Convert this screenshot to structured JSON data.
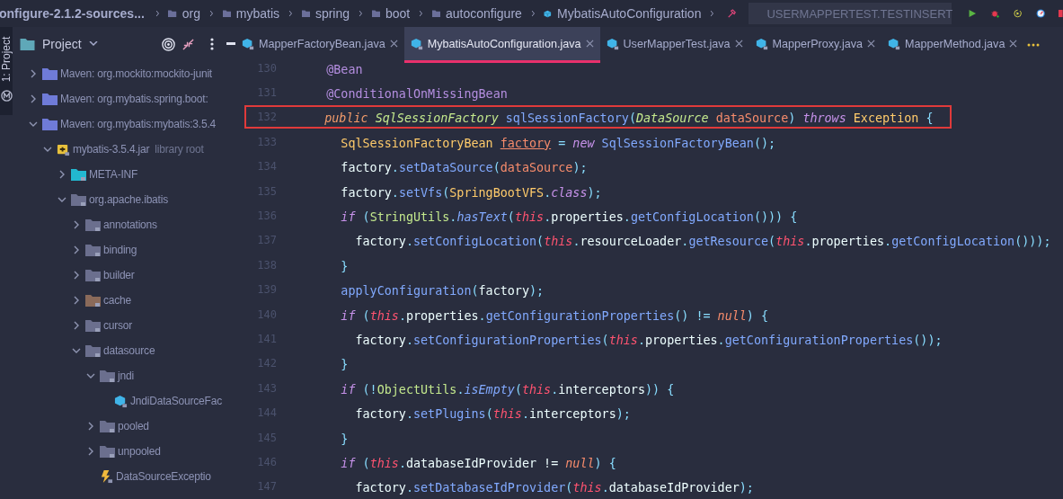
{
  "breadcrumb": {
    "project": "onfigure-2.1.2-sources...",
    "items": [
      {
        "label": "org",
        "kind": "folder"
      },
      {
        "label": "mybatis",
        "kind": "folder"
      },
      {
        "label": "spring",
        "kind": "folder"
      },
      {
        "label": "boot",
        "kind": "folder"
      },
      {
        "label": "autoconfigure",
        "kind": "folder"
      },
      {
        "label": "MybatisAutoConfiguration",
        "kind": "class"
      }
    ]
  },
  "run_config": {
    "label": "USERMAPPERTEST.TESTINSERT"
  },
  "tool_strip": {
    "label": "1: Project"
  },
  "sidebar": {
    "title": "Project",
    "tree": [
      {
        "label": "Maven: org.mockito:mockito-junit",
        "kind": "module",
        "expanded": false
      },
      {
        "label": "Maven: org.mybatis.spring.boot:",
        "kind": "module",
        "expanded": false
      },
      {
        "label": "Maven: org.mybatis:mybatis:3.5.4",
        "kind": "module",
        "expanded": true,
        "children": [
          {
            "label": "mybatis-3.5.4.jar",
            "suffix": "library root",
            "kind": "jar",
            "expanded": true,
            "children": [
              {
                "label": "META-INF",
                "kind": "resources",
                "expanded": false
              },
              {
                "label": "org.apache.ibatis",
                "kind": "package",
                "expanded": true,
                "children": [
                  {
                    "label": "annotations",
                    "kind": "package",
                    "expanded": false
                  },
                  {
                    "label": "binding",
                    "kind": "package",
                    "expanded": false
                  },
                  {
                    "label": "builder",
                    "kind": "package",
                    "expanded": false
                  },
                  {
                    "label": "cache",
                    "kind": "cache",
                    "expanded": false
                  },
                  {
                    "label": "cursor",
                    "kind": "package",
                    "expanded": false
                  },
                  {
                    "label": "datasource",
                    "kind": "package",
                    "expanded": true,
                    "children": [
                      {
                        "label": "jndi",
                        "kind": "package",
                        "expanded": true,
                        "children": [
                          {
                            "label": "JndiDataSourceFac",
                            "kind": "class"
                          }
                        ]
                      },
                      {
                        "label": "pooled",
                        "kind": "package",
                        "expanded": false
                      },
                      {
                        "label": "unpooled",
                        "kind": "package",
                        "expanded": false
                      },
                      {
                        "label": "DataSourceExceptio",
                        "kind": "exception"
                      }
                    ]
                  }
                ]
              }
            ]
          }
        ]
      }
    ]
  },
  "tabs": [
    {
      "label": "MapperFactoryBean.java",
      "selected": false
    },
    {
      "label": "MybatisAutoConfiguration.java",
      "selected": true
    },
    {
      "label": "UserMapperTest.java",
      "selected": false
    },
    {
      "label": "MapperProxy.java",
      "selected": false
    },
    {
      "label": "MapperMethod.java",
      "selected": false
    }
  ],
  "code": [
    {
      "number": "130",
      "boxed": false,
      "tokens": [
        {
          "kind": "ann",
          "text": "    @Bean"
        }
      ]
    },
    {
      "number": "131",
      "boxed": false,
      "tokens": [
        {
          "kind": "ann",
          "text": "    @ConditionalOnMissingBean"
        }
      ]
    },
    {
      "number": "132",
      "boxed": true,
      "tokens": [
        {
          "kind": "mod",
          "text": "    public "
        },
        {
          "kind": "iface",
          "text": "SqlSessionFactory "
        },
        {
          "kind": "method",
          "text": "sqlSessionFactory"
        },
        {
          "kind": "punct",
          "text": "("
        },
        {
          "kind": "iface",
          "text": "DataSource "
        },
        {
          "kind": "param",
          "text": "dataSource"
        },
        {
          "kind": "punct",
          "text": ") "
        },
        {
          "kind": "kw",
          "text": "throws "
        },
        {
          "kind": "type",
          "text": "Exception"
        },
        {
          "kind": "punct",
          "text": " {"
        }
      ]
    },
    {
      "number": "133",
      "boxed": false,
      "tokens": [
        {
          "kind": "type",
          "text": "      SqlSessionFactoryBean "
        },
        {
          "kind": "var",
          "text": "factory"
        },
        {
          "kind": "punct",
          "text": " = "
        },
        {
          "kind": "kw",
          "text": "new "
        },
        {
          "kind": "method",
          "text": "SqlSessionFactoryBean"
        },
        {
          "kind": "punct",
          "text": "();"
        }
      ]
    },
    {
      "number": "134",
      "boxed": false,
      "tokens": [
        {
          "kind": "plain",
          "text": "      factory"
        },
        {
          "kind": "punct",
          "text": "."
        },
        {
          "kind": "method",
          "text": "setDataSource"
        },
        {
          "kind": "punct",
          "text": "("
        },
        {
          "kind": "param",
          "text": "dataSource"
        },
        {
          "kind": "punct",
          "text": ");"
        }
      ]
    },
    {
      "number": "135",
      "boxed": false,
      "tokens": [
        {
          "kind": "plain",
          "text": "      factory"
        },
        {
          "kind": "punct",
          "text": "."
        },
        {
          "kind": "method",
          "text": "setVfs"
        },
        {
          "kind": "punct",
          "text": "("
        },
        {
          "kind": "type",
          "text": "SpringBootVFS"
        },
        {
          "kind": "punct",
          "text": "."
        },
        {
          "kind": "kw",
          "text": "class"
        },
        {
          "kind": "punct",
          "text": ");"
        }
      ]
    },
    {
      "number": "136",
      "boxed": false,
      "tokens": [
        {
          "kind": "kw",
          "text": "      if"
        },
        {
          "kind": "punct",
          "text": " ("
        },
        {
          "kind": "cls",
          "text": "StringUtils"
        },
        {
          "kind": "punct",
          "text": "."
        },
        {
          "kind": "static",
          "text": "hasText"
        },
        {
          "kind": "punct",
          "text": "("
        },
        {
          "kind": "this",
          "text": "this"
        },
        {
          "kind": "punct",
          "text": "."
        },
        {
          "kind": "plain",
          "text": "properties"
        },
        {
          "kind": "punct",
          "text": "."
        },
        {
          "kind": "method",
          "text": "getConfigLocation"
        },
        {
          "kind": "punct",
          "text": "())) {"
        }
      ]
    },
    {
      "number": "137",
      "boxed": false,
      "tokens": [
        {
          "kind": "plain",
          "text": "        factory"
        },
        {
          "kind": "punct",
          "text": "."
        },
        {
          "kind": "method",
          "text": "setConfigLocation"
        },
        {
          "kind": "punct",
          "text": "("
        },
        {
          "kind": "this",
          "text": "this"
        },
        {
          "kind": "punct",
          "text": "."
        },
        {
          "kind": "plain",
          "text": "resourceLoader"
        },
        {
          "kind": "punct",
          "text": "."
        },
        {
          "kind": "method",
          "text": "getResource"
        },
        {
          "kind": "punct",
          "text": "("
        },
        {
          "kind": "this",
          "text": "this"
        },
        {
          "kind": "punct",
          "text": "."
        },
        {
          "kind": "plain",
          "text": "properties"
        },
        {
          "kind": "punct",
          "text": "."
        },
        {
          "kind": "method",
          "text": "getConfigLocation"
        },
        {
          "kind": "punct",
          "text": "()));"
        }
      ]
    },
    {
      "number": "138",
      "boxed": false,
      "tokens": [
        {
          "kind": "punct",
          "text": "      }"
        }
      ]
    },
    {
      "number": "139",
      "boxed": false,
      "tokens": [
        {
          "kind": "method",
          "text": "      applyConfiguration"
        },
        {
          "kind": "punct",
          "text": "("
        },
        {
          "kind": "plain",
          "text": "factory"
        },
        {
          "kind": "punct",
          "text": ");"
        }
      ]
    },
    {
      "number": "140",
      "boxed": false,
      "tokens": [
        {
          "kind": "kw",
          "text": "      if"
        },
        {
          "kind": "punct",
          "text": " ("
        },
        {
          "kind": "this",
          "text": "this"
        },
        {
          "kind": "punct",
          "text": "."
        },
        {
          "kind": "plain",
          "text": "properties"
        },
        {
          "kind": "punct",
          "text": "."
        },
        {
          "kind": "method",
          "text": "getConfigurationProperties"
        },
        {
          "kind": "punct",
          "text": "() != "
        },
        {
          "kind": "lit",
          "text": "null"
        },
        {
          "kind": "punct",
          "text": ") {"
        }
      ]
    },
    {
      "number": "141",
      "boxed": false,
      "tokens": [
        {
          "kind": "plain",
          "text": "        factory"
        },
        {
          "kind": "punct",
          "text": "."
        },
        {
          "kind": "method",
          "text": "setConfigurationProperties"
        },
        {
          "kind": "punct",
          "text": "("
        },
        {
          "kind": "this",
          "text": "this"
        },
        {
          "kind": "punct",
          "text": "."
        },
        {
          "kind": "plain",
          "text": "properties"
        },
        {
          "kind": "punct",
          "text": "."
        },
        {
          "kind": "method",
          "text": "getConfigurationProperties"
        },
        {
          "kind": "punct",
          "text": "());"
        }
      ]
    },
    {
      "number": "142",
      "boxed": false,
      "tokens": [
        {
          "kind": "punct",
          "text": "      }"
        }
      ]
    },
    {
      "number": "143",
      "boxed": false,
      "tokens": [
        {
          "kind": "kw",
          "text": "      if"
        },
        {
          "kind": "punct",
          "text": " (!"
        },
        {
          "kind": "cls",
          "text": "ObjectUtils"
        },
        {
          "kind": "punct",
          "text": "."
        },
        {
          "kind": "static",
          "text": "isEmpty"
        },
        {
          "kind": "punct",
          "text": "("
        },
        {
          "kind": "this",
          "text": "this"
        },
        {
          "kind": "punct",
          "text": "."
        },
        {
          "kind": "plain",
          "text": "interceptors"
        },
        {
          "kind": "punct",
          "text": ")) {"
        }
      ]
    },
    {
      "number": "144",
      "boxed": false,
      "tokens": [
        {
          "kind": "plain",
          "text": "        factory"
        },
        {
          "kind": "punct",
          "text": "."
        },
        {
          "kind": "method",
          "text": "setPlugins"
        },
        {
          "kind": "punct",
          "text": "("
        },
        {
          "kind": "this",
          "text": "this"
        },
        {
          "kind": "punct",
          "text": "."
        },
        {
          "kind": "plain",
          "text": "interceptors"
        },
        {
          "kind": "punct",
          "text": ");"
        }
      ]
    },
    {
      "number": "145",
      "boxed": false,
      "tokens": [
        {
          "kind": "punct",
          "text": "      }"
        }
      ]
    },
    {
      "number": "146",
      "boxed": false,
      "tokens": [
        {
          "kind": "kw",
          "text": "      if"
        },
        {
          "kind": "punct",
          "text": " ("
        },
        {
          "kind": "this",
          "text": "this"
        },
        {
          "kind": "punct",
          "text": "."
        },
        {
          "kind": "plain",
          "text": "databaseIdProvider != "
        },
        {
          "kind": "lit",
          "text": "null"
        },
        {
          "kind": "punct",
          "text": ") {"
        }
      ]
    },
    {
      "number": "147",
      "boxed": false,
      "tokens": [
        {
          "kind": "plain",
          "text": "        factory"
        },
        {
          "kind": "punct",
          "text": "."
        },
        {
          "kind": "method",
          "text": "setDatabaseIdProvider"
        },
        {
          "kind": "punct",
          "text": "("
        },
        {
          "kind": "this",
          "text": "this"
        },
        {
          "kind": "punct",
          "text": "."
        },
        {
          "kind": "plain",
          "text": "databaseIdProvider"
        },
        {
          "kind": "punct",
          "text": ");"
        }
      ]
    }
  ]
}
